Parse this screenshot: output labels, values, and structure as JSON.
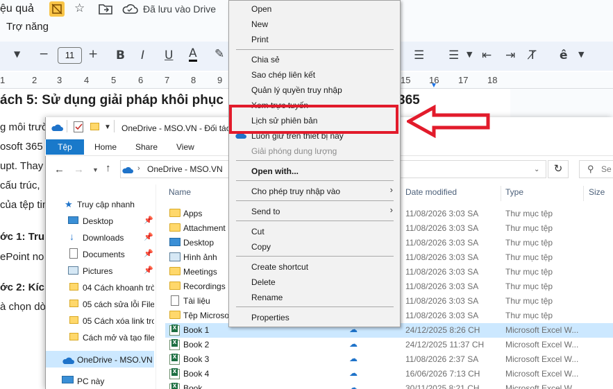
{
  "docs": {
    "title_fragment": "ệu quả",
    "saved_status": "Đã lưu vào Drive",
    "menu_accessibility": "Trợ năng",
    "font_size": "11",
    "ruler_numbers": [
      "1",
      "2",
      "3",
      "4",
      "5",
      "6",
      "7",
      "8",
      "9",
      "15",
      "16",
      "17",
      "18"
    ],
    "heading": "ách 5: Sử dụng giải pháp khôi phục",
    "heading_tail": "365",
    "para_lines": [
      "g môi trườ",
      "osoft 365",
      "upt. Thay",
      "cấu trúc,",
      "của tệp tin"
    ],
    "step1_fragment": "ớc 1: Tru",
    "step1_line": "ePoint no",
    "step2_fragment": "ớc 2: Kíc",
    "step2_line": "à chọn dò"
  },
  "explorer": {
    "title": "OneDrive - MSO.VN - Đối tác",
    "ribbon_tabs": [
      "Tệp",
      "Home",
      "Share",
      "View"
    ],
    "address_path": "OneDrive - MSO.VN",
    "search_placeholder": "Se",
    "nav_items": [
      {
        "label": "Truy cập nhanh",
        "icon": "star-icon"
      },
      {
        "label": "Desktop",
        "icon": "desktop-icon",
        "pinned": true
      },
      {
        "label": "Downloads",
        "icon": "download-icon",
        "pinned": true
      },
      {
        "label": "Documents",
        "icon": "documents-icon",
        "pinned": true
      },
      {
        "label": "Pictures",
        "icon": "pictures-icon",
        "pinned": true
      },
      {
        "label": "04 Cách khoanh trò",
        "icon": "folder-icon"
      },
      {
        "label": "05 cách sửa lỗi File l",
        "icon": "folder-icon"
      },
      {
        "label": "05 Cách xóa link tro",
        "icon": "folder-icon"
      },
      {
        "label": "Cách mở và tạo file",
        "icon": "folder-icon"
      },
      {
        "label": "OneDrive - MSO.VN -",
        "icon": "cloud-icon"
      },
      {
        "label": "PC này",
        "icon": "pc-icon"
      }
    ],
    "columns": [
      "Name",
      "Date modified",
      "Type",
      "Size"
    ],
    "rows": [
      {
        "name": "Apps",
        "date": "11/08/2026 3:03 SA",
        "type": "Thư mục tệp",
        "icon": "folder-icon"
      },
      {
        "name": "Attachment",
        "date": "11/08/2026 3:03 SA",
        "type": "Thư mục tệp",
        "icon": "folder-icon"
      },
      {
        "name": "Desktop",
        "date": "11/08/2026 3:03 SA",
        "type": "Thư mục tệp",
        "icon": "desktop-icon"
      },
      {
        "name": "Hình ảnh",
        "date": "11/08/2026 3:03 SA",
        "type": "Thư mục tệp",
        "icon": "pictures-icon"
      },
      {
        "name": "Meetings",
        "date": "11/08/2026 3:03 SA",
        "type": "Thư mục tệp",
        "icon": "folder-icon"
      },
      {
        "name": "Recordings",
        "date": "11/08/2026 3:03 SA",
        "type": "Thư mục tệp",
        "icon": "folder-icon"
      },
      {
        "name": "Tài liệu",
        "date": "11/08/2026 3:03 SA",
        "type": "Thư mục tệp",
        "icon": "documents-icon"
      },
      {
        "name": "Tệp Microso",
        "date": "11/08/2026 3:03 SA",
        "type": "Thư mục tệp",
        "icon": "folder-icon"
      },
      {
        "name": "Book 1",
        "date": "24/12/2025 8:26 CH",
        "type": "Microsoft Excel W...",
        "icon": "excel-icon",
        "cloud": true,
        "selected": true
      },
      {
        "name": "Book 2",
        "date": "24/12/2025 11:37 CH",
        "type": "Microsoft Excel W...",
        "icon": "excel-icon",
        "cloud": true
      },
      {
        "name": "Book 3",
        "date": "11/08/2026 2:37 SA",
        "type": "Microsoft Excel W...",
        "icon": "excel-icon",
        "cloud": true
      },
      {
        "name": "Book 4",
        "date": "16/06/2026 7:13 CH",
        "type": "Microsoft Excel W...",
        "icon": "excel-icon",
        "cloud": true
      },
      {
        "name": "Book",
        "date": "30/11/2025 8:21 CH",
        "type": "Microsoft Excel W...",
        "icon": "excel-icon",
        "cloud": true
      }
    ]
  },
  "context_menu": {
    "open": "Open",
    "new": "New",
    "print": "Print",
    "share": "Chia sẻ",
    "copy_link": "Sao chép liên kết",
    "manage_access": "Quản lý quyền truy nhập",
    "view_online": "Xem trực tuyến",
    "version_history": "Lịch sử phiên bản",
    "always_keep": "Luôn giữ trên thiết bị này",
    "free_space": "Giải phóng dung lượng",
    "open_with": "Open with...",
    "give_access": "Cho phép truy nhập vào",
    "send_to": "Send to",
    "cut": "Cut",
    "copy": "Copy",
    "create_shortcut": "Create shortcut",
    "delete": "Delete",
    "rename": "Rename",
    "properties": "Properties"
  },
  "colors": {
    "highlight": "#e21b2b",
    "selection": "#cce8ff",
    "ribbon_file_tab": "#1979ca"
  }
}
